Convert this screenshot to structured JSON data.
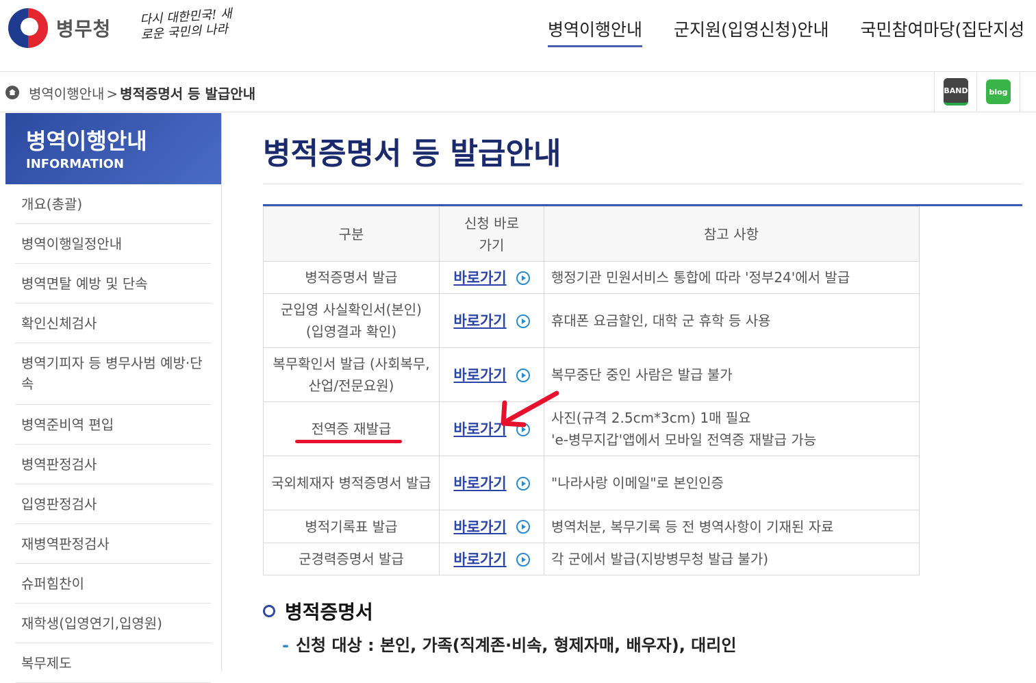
{
  "header": {
    "logo_text": "병무청",
    "slogan": "다시 대한민국! 새로운 국민의 나라",
    "nav": [
      "병역이행안내",
      "군지원(입영신청)안내",
      "국민참여마당(집단지성"
    ]
  },
  "breadcrumb": {
    "parent": "병역이행안내",
    "separator": ">",
    "current": "병적증명서 등 발급안내",
    "sns": [
      "BAND",
      "blog"
    ]
  },
  "sidebar": {
    "title": "병역이행안내",
    "subtitle": "INFORMATION",
    "items": [
      "개요(총괄)",
      "병역이행일정안내",
      "병역면탈 예방 및 단속",
      "확인신체검사",
      "병역기피자 등 병무사범 예방·단속",
      "병역준비역 편입",
      "병역판정검사",
      "입영판정검사",
      "재병역판정검사",
      "슈퍼힘찬이",
      "재학생(입영연기,입영원)",
      "복무제도"
    ]
  },
  "main": {
    "title": "병적증명서 등 발급안내",
    "table": {
      "headers": [
        "구분",
        "신청 바로가기",
        "참고 사항"
      ],
      "link_label": "바로가기",
      "rows": [
        {
          "category": "병적증명서 발급",
          "note": "행정기관 민원서비스 통합에 따라 '정부24'에서 발급"
        },
        {
          "category": "군입영 사실확인서(본인) (입영결과 확인)",
          "note": "휴대폰 요금할인, 대학 군 휴학 등 사용"
        },
        {
          "category": "복무확인서 발급 (사회복무, 산업/전문요원)",
          "note": "복무중단 중인 사람은 발급 불가"
        },
        {
          "category": "전역증 재발급",
          "note": "사진(규격 2.5cm*3cm) 1매 필요",
          "note2": "'e-병무지갑'앱에서 모바일 전역증 재발급 가능"
        },
        {
          "category": "국외체재자 병적증명서 발급",
          "note": "\"나라사랑 이메일\"로 본인인증"
        },
        {
          "category": "병적기록표 발급",
          "note": "병역처분, 복무기록 등 전 병역사항이 기재된 자료"
        },
        {
          "category": "군경력증명서 발급",
          "note": "각 군에서 발급(지방병무청 발급 불가)"
        }
      ]
    },
    "section_title": "병적증명서",
    "section_item": "신청 대상 : 본인, 가족(직계존·비속, 형제자매, 배우자), 대리인",
    "annotation_color": "#e8112d"
  }
}
